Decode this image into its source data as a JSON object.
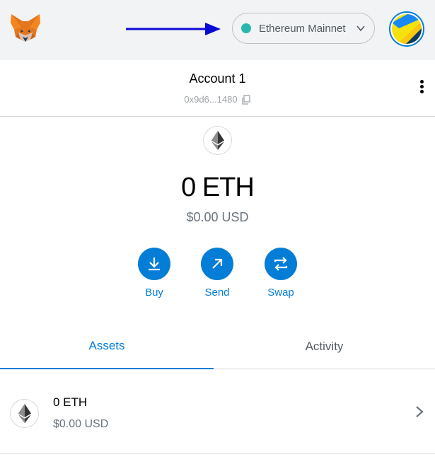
{
  "header": {
    "network": {
      "label": "Ethereum Mainnet",
      "dot_color": "#29b6af",
      "icon": "chevron-down-icon"
    },
    "logo_icon": "metamask-fox-icon",
    "avatar_icon": "jazzicon-avatar-icon"
  },
  "account": {
    "name": "Account 1",
    "address": "0x9d6...1480",
    "copy_icon": "copy-icon",
    "menu_icon": "kebab-menu-icon"
  },
  "balance": {
    "token_icon": "ethereum-icon",
    "primary": "0 ETH",
    "secondary": "$0.00 USD"
  },
  "actions": [
    {
      "label": "Buy",
      "icon": "download-icon"
    },
    {
      "label": "Send",
      "icon": "arrow-up-right-icon"
    },
    {
      "label": "Swap",
      "icon": "swap-arrows-icon"
    }
  ],
  "tabs": [
    {
      "label": "Assets",
      "active": true
    },
    {
      "label": "Activity",
      "active": false
    }
  ],
  "assets": [
    {
      "primary": "0 ETH",
      "secondary": "$0.00 USD",
      "icon": "ethereum-icon"
    }
  ],
  "colors": {
    "accent": "#037dd6",
    "header_bg": "#f2f3f4",
    "annotation_arrow": "#0a0ad6"
  }
}
